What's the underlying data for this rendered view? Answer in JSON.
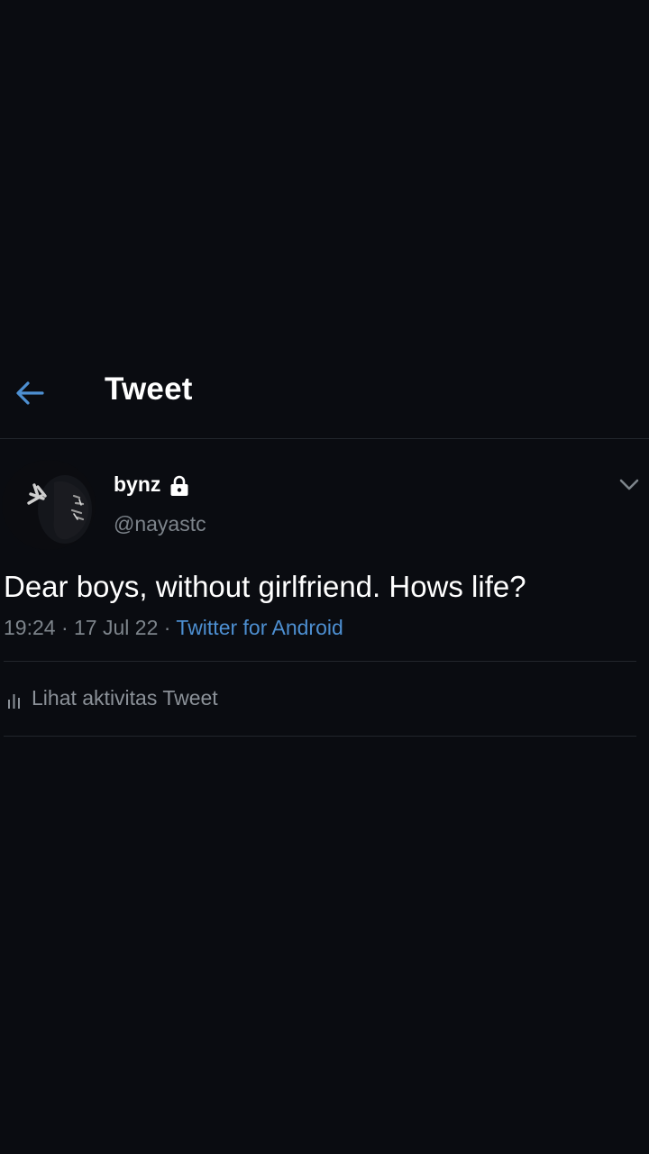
{
  "header": {
    "back_icon": "arrow-left-icon",
    "title": "Tweet"
  },
  "tweet": {
    "author": {
      "display_name": "bynz",
      "protected_icon": "lock-icon",
      "handle": "@nayastc"
    },
    "more_icon": "chevron-down-icon",
    "text": "Dear boys, without girlfriend. Hows life?",
    "time": "19:24",
    "separator": "·",
    "date": "17 Jul 22",
    "source": "Twitter for Android",
    "activity": {
      "icon": "bar-chart-icon",
      "label": "Lihat aktivitas Tweet"
    }
  },
  "colors": {
    "background": "#0a0c11",
    "accent": "#4d8fd1",
    "text_primary": "#ffffff",
    "text_secondary": "#7d848b",
    "divider": "#22262c"
  }
}
